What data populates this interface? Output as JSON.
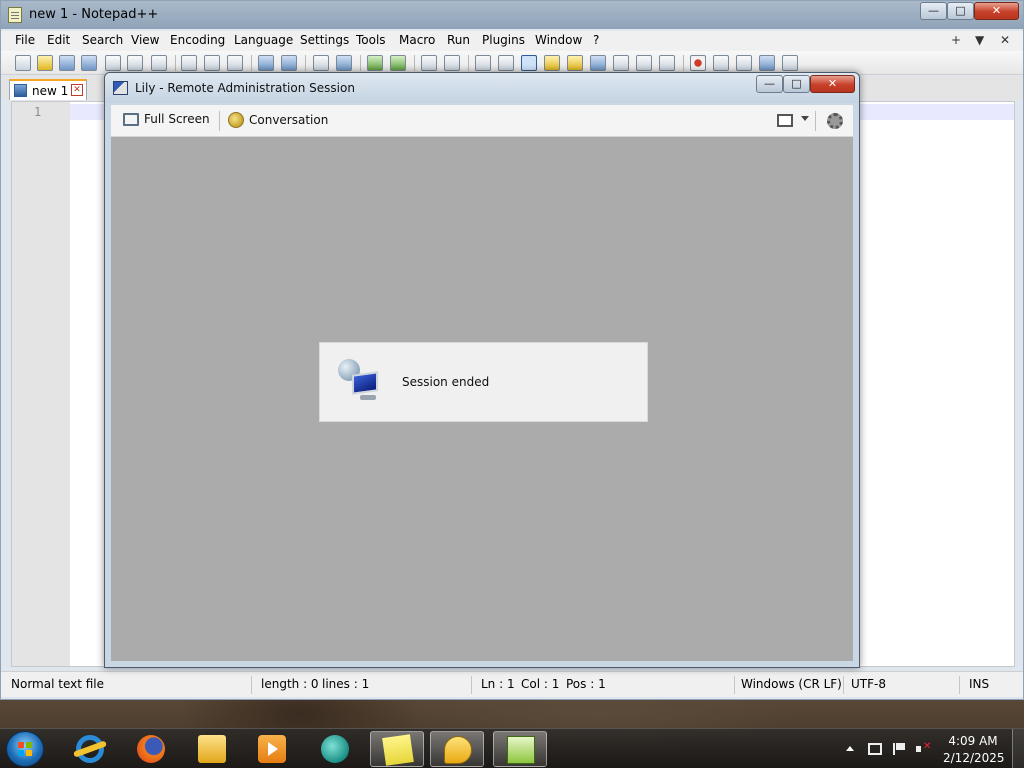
{
  "notepad": {
    "title": "new 1 - Notepad++",
    "window_buttons": {
      "minimize": "—",
      "maximize": "□",
      "close": "✕"
    },
    "menu": [
      "File",
      "Edit",
      "Search",
      "View",
      "Encoding",
      "Language",
      "Settings",
      "Tools",
      "Macro",
      "Run",
      "Plugins",
      "Window",
      "?"
    ],
    "menu_right": {
      "plus": "+",
      "down": "▼",
      "close": "✕"
    },
    "tab": {
      "label": "new 1",
      "close": "✕"
    },
    "editor": {
      "line_number": "1"
    },
    "status": {
      "file_type": "Normal text file",
      "length": "length : 0",
      "lines": "lines : 1",
      "ln": "Ln : 1",
      "col": "Col : 1",
      "pos": "Pos : 1",
      "eol": "Windows (CR LF)",
      "encoding": "UTF-8",
      "mode": "INS"
    }
  },
  "remote_session": {
    "title": "Lily - Remote Administration Session",
    "window_buttons": {
      "minimize": "—",
      "maximize": "□",
      "close": "✕"
    },
    "toolbar": {
      "full_screen": "Full Screen",
      "conversation": "Conversation"
    },
    "dialog": {
      "message": "Session ended"
    }
  },
  "taskbar": {
    "apps": [
      "internet-explorer",
      "firefox",
      "file-explorer",
      "media-player",
      "browser-globe",
      "sticky-notes",
      "chat",
      "notepad-plus-plus"
    ],
    "clock": {
      "time": "4:09 AM",
      "date": "2/12/2025"
    }
  }
}
